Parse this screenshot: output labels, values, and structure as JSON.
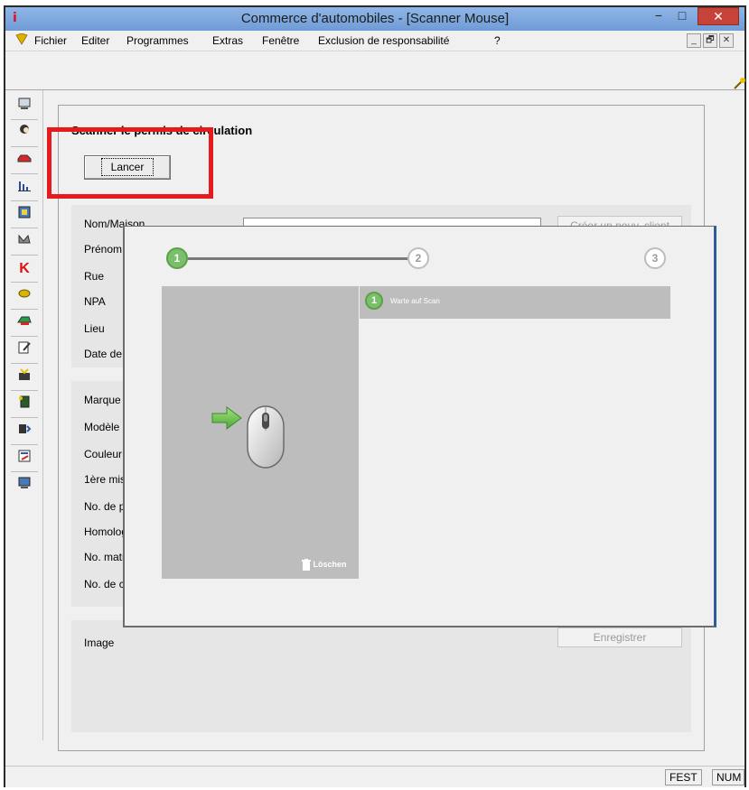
{
  "window": {
    "title": "Commerce d'automobiles - [Scanner Mouse]",
    "app_icon": "app-logo-icon",
    "controls": {
      "minimize": "−",
      "maximize": "□",
      "close": "✕"
    }
  },
  "menubar": {
    "items": [
      "Fichier",
      "Editer",
      "Programmes",
      "Extras",
      "Fenêtre",
      "Exclusion de responsabilité",
      "?"
    ],
    "mdi_controls": [
      "_",
      "🗗",
      "✕"
    ]
  },
  "leftbar": {
    "icons": [
      "computer-icon",
      "person-icon",
      "car-icon",
      "chart-icon",
      "film-icon",
      "tools-icon",
      "k-icon",
      "coin-icon",
      "car-parts-icon",
      "edit-icon",
      "import-icon",
      "document-icon",
      "swap-icon",
      "form-icon",
      "monitor-icon"
    ]
  },
  "child": {
    "section_title": "Scanner le permis de circulation",
    "lancer_label": "Lancer",
    "client_labels": [
      "Nom/Maison",
      "Prénom",
      "Rue",
      "NPA",
      "Lieu",
      "Date de"
    ],
    "vehicle_labels": [
      "Marque",
      "Modèle",
      "Couleur",
      "1ère mis",
      "No. de p",
      "Homolog",
      "No. matr",
      "No. de c"
    ],
    "image_label": "Image",
    "new_client_label": "Créer un nouv. client",
    "save_label": "Enregistrer"
  },
  "overlay": {
    "steps": [
      "1",
      "2",
      "3"
    ],
    "current_step": 1,
    "list_item_number": "1",
    "list_item_text": "Warte auf Scan",
    "delete_label": "Löschen"
  },
  "statusbar": {
    "cells": [
      "FEST",
      "NUM"
    ]
  },
  "colors": {
    "accent_green": "#7bbf6a",
    "highlight_red": "#e6191c",
    "titlebar_blue": "#7aa6dd",
    "close_red": "#c7433a"
  }
}
